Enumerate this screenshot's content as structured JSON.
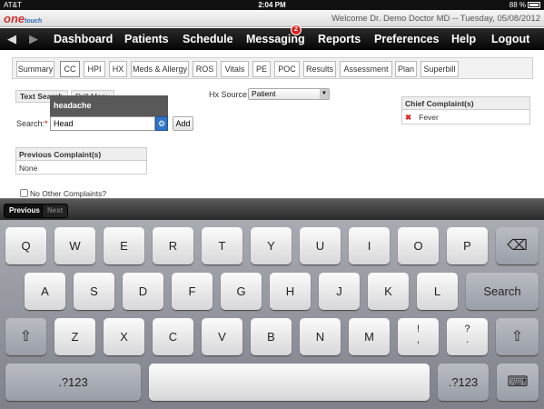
{
  "status_bar": {
    "carrier": "AT&T",
    "time": "2:04 PM",
    "battery": "88 %"
  },
  "header": {
    "logo_main": "one",
    "logo_sub": "touch",
    "welcome": "Welcome Dr. Demo Doctor MD -- Tuesday, 05/08/2012"
  },
  "nav": {
    "back_icon": "◀",
    "forward_icon": "▶",
    "items": [
      "Dashboard",
      "Patients",
      "Schedule",
      "Messaging",
      "Reports",
      "Preferences",
      "Help",
      "Logout"
    ],
    "messaging_badge": "2"
  },
  "tabs": [
    "Summary",
    "CC",
    "HPI",
    "HX",
    "Meds & Allergy",
    "ROS",
    "Vitals",
    "PE",
    "POC",
    "Results",
    "Assessment",
    "Plan",
    "Superbill"
  ],
  "active_tab": "CC",
  "form": {
    "text_search_label": "Text Search",
    "drill_menu_label": "Drill Menu",
    "suggestion": "headache",
    "search_label": "Search:",
    "search_required": "*",
    "search_value": "Head",
    "add_label": "Add",
    "hx_source_label": "Hx Source:",
    "hx_source_value": "Patient",
    "previous_title": "Previous Complaint(s)",
    "previous_value": "None",
    "no_other_label": "No Other Complaints?",
    "chief_title": "Chief Complaint(s)",
    "chief_item": "Fever"
  },
  "accessory": {
    "previous": "Previous",
    "next": "Next"
  },
  "keyboard": {
    "row1": [
      "Q",
      "W",
      "E",
      "R",
      "T",
      "Y",
      "U",
      "I",
      "O",
      "P"
    ],
    "row2": [
      "A",
      "S",
      "D",
      "F",
      "G",
      "H",
      "J",
      "K",
      "L"
    ],
    "row3": [
      "Z",
      "X",
      "C",
      "V",
      "B",
      "N",
      "M"
    ],
    "backspace": "⌫",
    "search": "Search",
    "shift": "⇧",
    "exclaim_top": "!",
    "exclaim_bottom": ",",
    "question_top": "?",
    "question_bottom": ".",
    "num_left": ".?123",
    "num_right": ".?123",
    "space": "",
    "hide": "⌨"
  }
}
